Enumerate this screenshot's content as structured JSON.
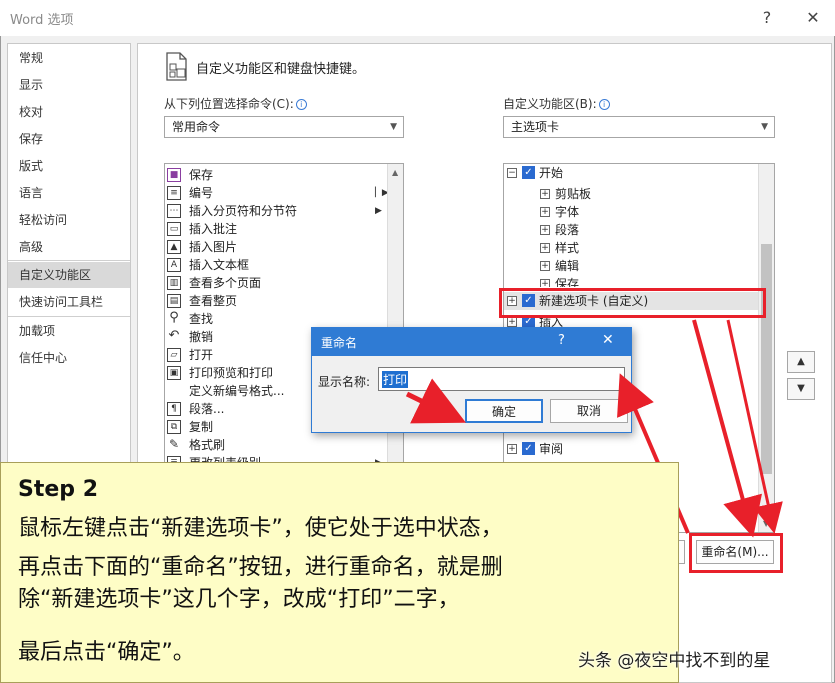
{
  "window": {
    "title": "Word 选项",
    "help": "?",
    "close": "✕"
  },
  "categories": [
    "常规",
    "显示",
    "校对",
    "保存",
    "版式",
    "语言",
    "轻松访问",
    "高级",
    "自定义功能区",
    "快速访问工具栏",
    "加载项",
    "信任中心"
  ],
  "header": {
    "text": "自定义功能区和键盘快捷键。"
  },
  "left": {
    "label": "从下列位置选择命令(C):",
    "select": "常用命令",
    "commands": [
      {
        "icon": "save-icon",
        "label": "保存"
      },
      {
        "icon": "numbering-icon",
        "label": "编号"
      },
      {
        "icon": "page-break-icon",
        "label": "插入分页符和分节符"
      },
      {
        "icon": "comment-icon",
        "label": "插入批注"
      },
      {
        "icon": "picture-icon",
        "label": "插入图片"
      },
      {
        "icon": "textbox-icon",
        "label": "插入文本框"
      },
      {
        "icon": "multipage-icon",
        "label": "查看多个页面"
      },
      {
        "icon": "wholepage-icon",
        "label": "查看整页"
      },
      {
        "icon": "find-icon",
        "label": "查找"
      },
      {
        "icon": "undo-icon",
        "label": "撤销"
      },
      {
        "icon": "print-icon",
        "label": "打开"
      },
      {
        "icon": "print-preview-icon",
        "label": "打印预览和打印"
      },
      {
        "icon": "blank-icon",
        "label": "定义新编号格式..."
      },
      {
        "icon": "paragraph-icon",
        "label": "段落..."
      },
      {
        "icon": "copy-icon",
        "label": "复制"
      },
      {
        "icon": "format-painter-icon",
        "label": "格式刷"
      },
      {
        "icon": "list-level-icon",
        "label": "更改列表级别"
      }
    ]
  },
  "right": {
    "label": "自定义功能区(B):",
    "select": "主选项卡",
    "tree": [
      {
        "level": 0,
        "sign": "⊟",
        "checked": true,
        "label": "开始"
      },
      {
        "level": 1,
        "sign": "⊞",
        "checked": false,
        "label": "剪贴板"
      },
      {
        "level": 1,
        "sign": "⊞",
        "checked": false,
        "label": "字体"
      },
      {
        "level": 1,
        "sign": "⊞",
        "checked": false,
        "label": "段落"
      },
      {
        "level": 1,
        "sign": "⊞",
        "checked": false,
        "label": "样式"
      },
      {
        "level": 1,
        "sign": "⊞",
        "checked": false,
        "label": "编辑"
      },
      {
        "level": 1,
        "sign": "⊞",
        "checked": false,
        "label": "保存"
      },
      {
        "level": 0,
        "sign": "⊞",
        "checked": true,
        "label": "新建选项卡 (自定义)"
      },
      {
        "level": 0,
        "sign": "⊞",
        "checked": true,
        "label": "插入"
      },
      {
        "level": 0,
        "sign": "⊞",
        "checked": true,
        "label": "审阅"
      }
    ],
    "rename_button": "重命名(M)..."
  },
  "dialog": {
    "title": "重命名",
    "help": "?",
    "close": "✕",
    "field_label": "显示名称:",
    "field_value": "打印",
    "ok": "确定",
    "cancel": "取消"
  },
  "note": {
    "step": "Step 2",
    "lines": [
      "鼠标左键点击“新建选项卡”，使它处于选中状态，",
      "再点击下面的“重命名”按钮，进行重命名，就是删",
      "除“新建选项卡”这几个字，改成“打印”二字，",
      "最后点击“确定”。"
    ]
  },
  "watermark": "头条 @夜空中找不到的星",
  "colors": {
    "accent": "#2f7bd4",
    "highlight": "#e8202a",
    "note_bg": "#fefdc6"
  }
}
